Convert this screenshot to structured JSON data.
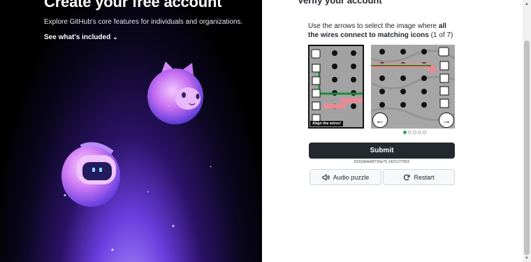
{
  "hero": {
    "title": "Create your free account",
    "subtitle": "Explore GitHub's core features for individuals and organizations.",
    "link": "See what's included",
    "chevron": "⌄"
  },
  "verify": {
    "title": "Verify your account",
    "instruction_pre": "Use the arrows to select the image where ",
    "instruction_bold": "all the wires connect to matching icons",
    "instruction_post": " (1 of 7)",
    "puzzle_label": "Align the wires!",
    "prev_arrow": "←",
    "next_arrow": "→",
    "submit": "Submit",
    "token": "53316b6d9f733e75.1421277002",
    "audio": "Audio puzzle",
    "restart": "Restart",
    "colors": {
      "button": "#24292f",
      "wire_green": "#1f8a3a",
      "wire_pink": "#e88a94",
      "active_dot": "#2da44e"
    }
  },
  "scrollbar": {
    "up": "▲",
    "down": "▼"
  }
}
